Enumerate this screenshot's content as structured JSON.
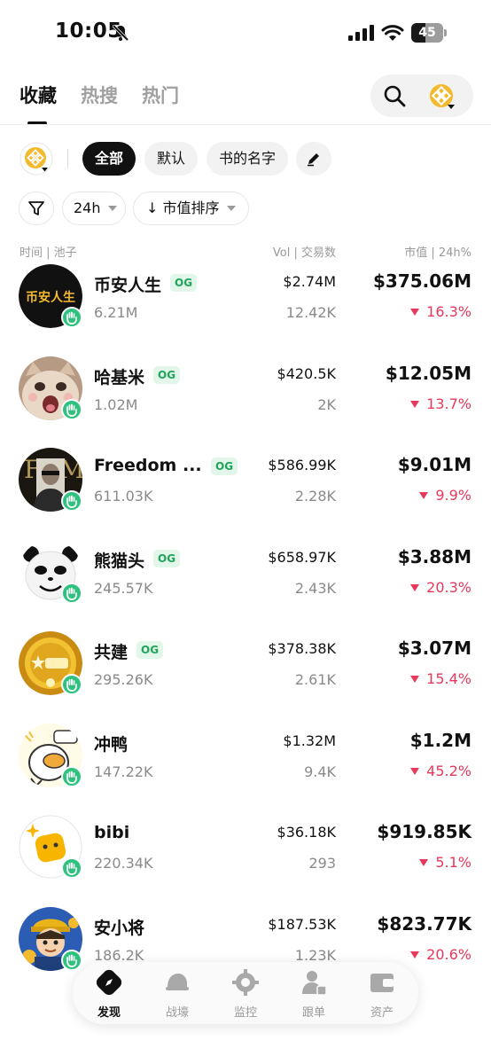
{
  "status_bar": {
    "time": "10:05",
    "battery": "45",
    "battery_level": 0.45
  },
  "tabs": [
    {
      "label": "收藏",
      "active": true
    },
    {
      "label": "热搜",
      "active": false
    },
    {
      "label": "热门",
      "active": false
    }
  ],
  "filters": {
    "chips": [
      {
        "label": "全部",
        "active": true
      },
      {
        "label": "默认",
        "active": false
      },
      {
        "label": "书的名字",
        "active": false
      }
    ],
    "period": "24h",
    "sort": "↓ 市值排序"
  },
  "columns": {
    "left": "时间 | 池子",
    "middle": "Vol | 交易数",
    "right": "市值 | 24h%"
  },
  "og_label": "OG",
  "tokens": [
    {
      "name": "币安人生",
      "og": true,
      "pool": "6.21M",
      "vol": "$2.74M",
      "txns": "12.42K",
      "mcap": "$375.06M",
      "change": "16.3%",
      "avatar": "text-logo",
      "avatar_text": "币安人生"
    },
    {
      "name": "哈基米",
      "og": true,
      "pool": "1.02M",
      "vol": "$420.5K",
      "txns": "2K",
      "mcap": "$12.05M",
      "change": "13.7%",
      "avatar": "cat-face"
    },
    {
      "name": "Freedom ...",
      "og": true,
      "pool": "611.03K",
      "vol": "$586.99K",
      "txns": "2.28K",
      "mcap": "$9.01M",
      "change": "9.9%",
      "avatar": "book-cover"
    },
    {
      "name": "熊猫头",
      "og": true,
      "pool": "245.57K",
      "vol": "$658.97K",
      "txns": "2.43K",
      "mcap": "$3.88M",
      "change": "20.3%",
      "avatar": "panda-face"
    },
    {
      "name": "共建",
      "og": true,
      "pool": "295.26K",
      "vol": "$378.38K",
      "txns": "2.61K",
      "mcap": "$3.07M",
      "change": "15.4%",
      "avatar": "gold-coin"
    },
    {
      "name": "冲鸭",
      "og": false,
      "pool": "147.22K",
      "vol": "$1.32M",
      "txns": "9.4K",
      "mcap": "$1.2M",
      "change": "45.2%",
      "avatar": "duck-cartoon"
    },
    {
      "name": "bibi",
      "og": false,
      "pool": "220.34K",
      "vol": "$36.18K",
      "txns": "293",
      "mcap": "$919.85K",
      "change": "5.1%",
      "avatar": "yellow-square"
    },
    {
      "name": "安小将",
      "og": false,
      "pool": "186.2K",
      "vol": "$187.53K",
      "txns": "1.23K",
      "mcap": "$823.77K",
      "change": "20.6%",
      "avatar": "general-cartoon"
    }
  ],
  "nav": [
    {
      "label": "发现",
      "icon": "compass-icon",
      "active": true
    },
    {
      "label": "战壕",
      "icon": "helmet-icon",
      "active": false
    },
    {
      "label": "监控",
      "icon": "target-icon",
      "active": false
    },
    {
      "label": "跟单",
      "icon": "people-icon",
      "active": false
    },
    {
      "label": "资产",
      "icon": "wallet-icon",
      "active": false
    }
  ],
  "colors": {
    "brand": "#f3ba2f",
    "down": "#e8385b",
    "og_green": "#1fa45a",
    "hand_badge": "#2ec27e"
  }
}
